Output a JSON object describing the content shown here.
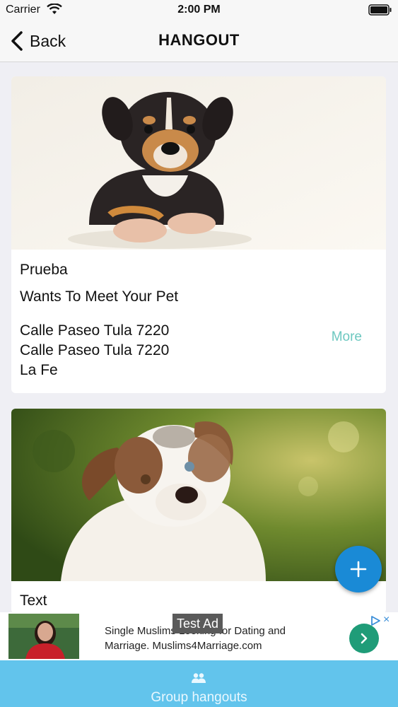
{
  "status_bar": {
    "carrier": "Carrier",
    "time": "2:00 PM"
  },
  "nav": {
    "back_label": "Back",
    "title": "HANGOUT"
  },
  "cards": [
    {
      "name": "Prueba",
      "subtitle": "Wants To Meet Your Pet",
      "address_lines": [
        "Calle Paseo Tula 7220",
        "Calle Paseo Tula 7220",
        "La Fe"
      ],
      "more_label": "More",
      "photo": "puppy-photo"
    },
    {
      "name": "Text",
      "photo": "dog-photo"
    }
  ],
  "fab": {
    "icon": "plus-icon"
  },
  "ad": {
    "badge": "Test Ad",
    "text_line1": "Single Muslims Looking for Dating and",
    "text_line2": "Marriage. Muslims4Marriage.com",
    "choices_icon": "ad-choices-icon",
    "close_symbol": "×"
  },
  "bottom_bar": {
    "icon": "group-icon",
    "label": "Group hangouts"
  },
  "colors": {
    "accent": "#62c4ec",
    "fab": "#1a8ad6",
    "more_link": "#6dc8c0",
    "ad_button": "#1f9c78"
  }
}
